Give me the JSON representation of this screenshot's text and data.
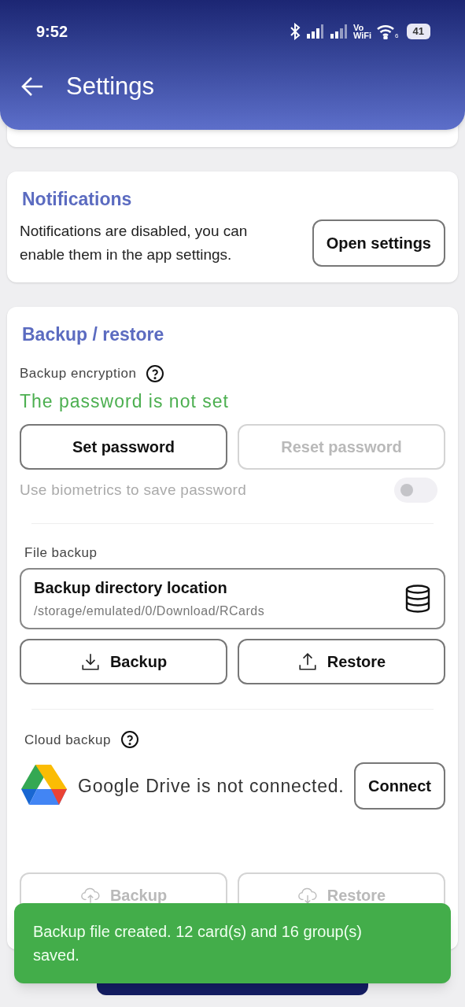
{
  "status_bar": {
    "time": "9:52",
    "vo_label": "Vo",
    "wifi_label": "WiFi",
    "wifi_generation": "6",
    "battery": "41"
  },
  "app_bar": {
    "title": "Settings"
  },
  "notifications": {
    "title": "Notifications",
    "message": "Notifications are disabled, you can enable them in the app settings.",
    "button": "Open settings"
  },
  "backup": {
    "title": "Backup / restore",
    "encryption": {
      "label": "Backup encryption",
      "status": "The password is not set",
      "buttons": [
        {
          "label": "Set password",
          "disabled": false
        },
        {
          "label": "Reset password",
          "disabled": true
        }
      ],
      "biometrics": {
        "label": "Use biometrics to save password",
        "on": false,
        "disabled": true
      }
    },
    "file_backup": {
      "label": "File backup",
      "location": {
        "title": "Backup directory location",
        "path": "/storage/emulated/0/Download/RCards"
      },
      "buttons": [
        {
          "label": "Backup",
          "disabled": false
        },
        {
          "label": "Restore",
          "disabled": false
        }
      ]
    },
    "cloud_backup": {
      "label": "Cloud backup",
      "status": "Google Drive is not connected.",
      "connect_button": "Connect",
      "buttons": [
        {
          "label": "Backup",
          "disabled": true
        },
        {
          "label": "Restore",
          "disabled": true
        }
      ]
    }
  },
  "snackbar": {
    "message": "Backup file created. 12 card(s) and 16 group(s) saved."
  }
}
